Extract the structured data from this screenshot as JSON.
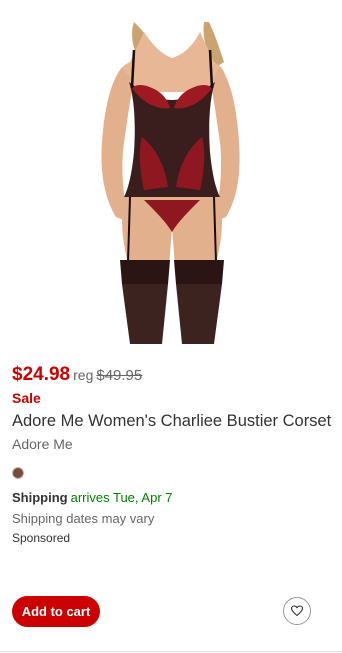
{
  "product": {
    "price_current": "$24.98",
    "price_reg_prefix": "reg",
    "price_reg": "$49.95",
    "sale_label": "Sale",
    "title": "Adore Me Women's Charliee Bustier Corset",
    "brand": "Adore Me",
    "swatch_color": "#7a4a38",
    "image_icon": "product-photo"
  },
  "shipping": {
    "label": "Shipping",
    "arrival": "arrives Tue, Apr 7",
    "note": "Shipping dates may vary"
  },
  "sponsored_label": "Sponsored",
  "actions": {
    "add_to_cart_label": "Add to cart",
    "favorite_icon": "heart-icon"
  },
  "colors": {
    "accent": "#cc0000",
    "shipping_green": "#008300"
  }
}
